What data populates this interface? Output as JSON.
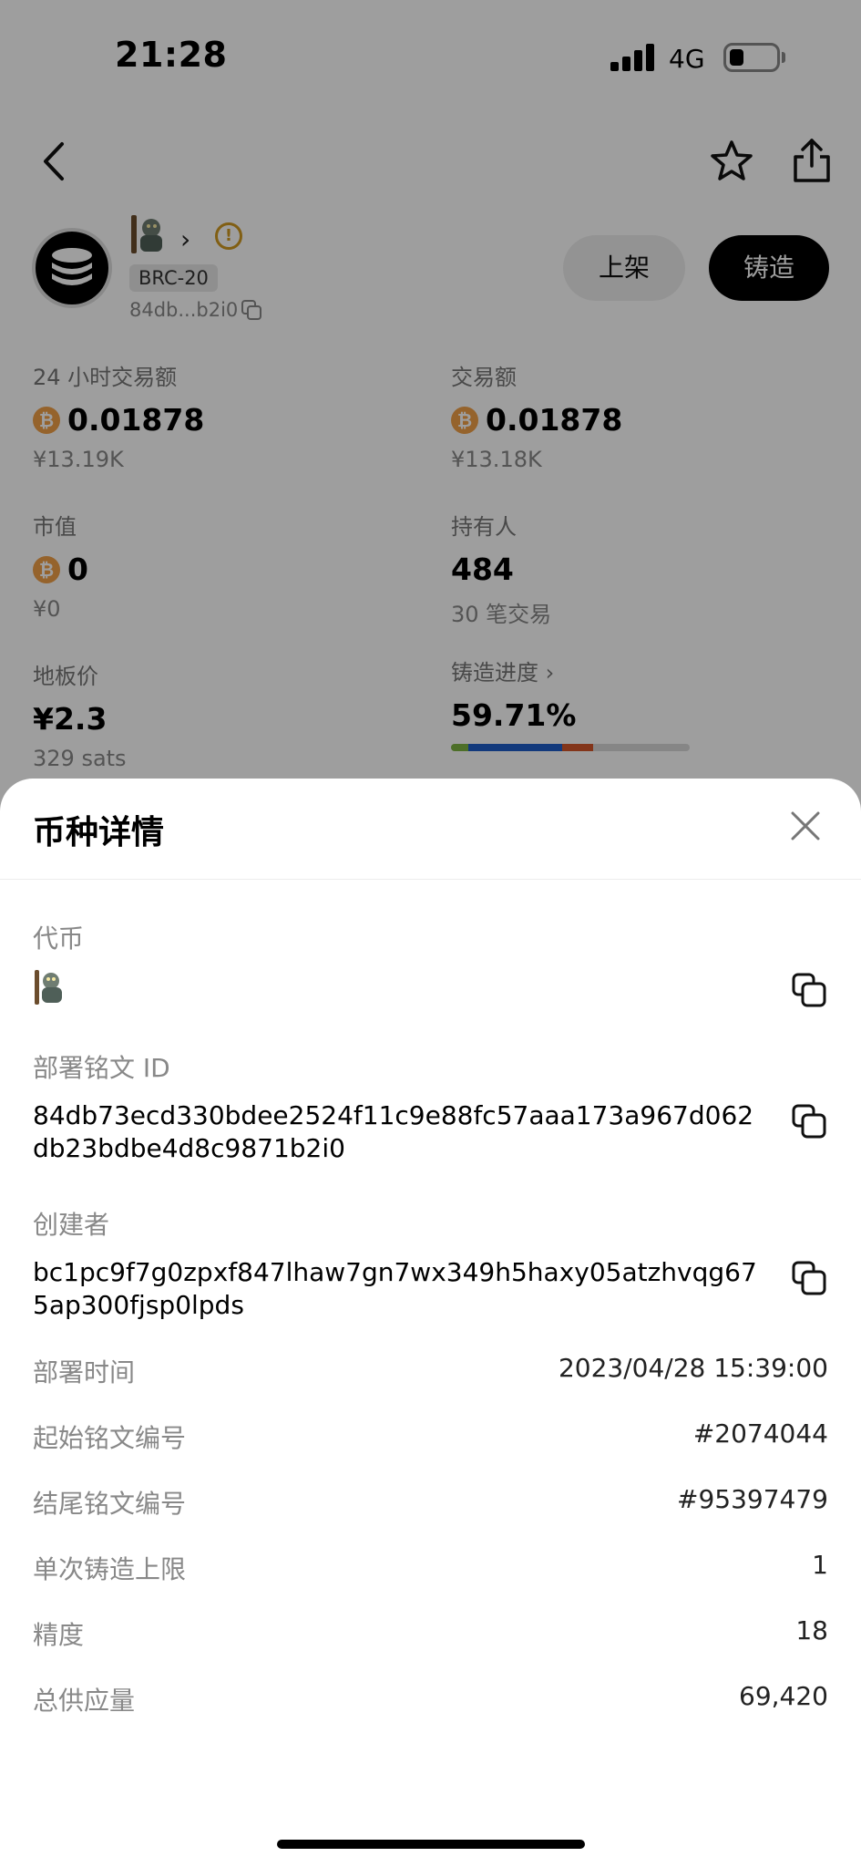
{
  "status": {
    "time": "21:28",
    "network": "4G"
  },
  "nav": {
    "back_icon": "chevron-left-icon",
    "star_icon": "star-icon",
    "share_icon": "share-icon"
  },
  "token": {
    "badge": "BRC-20",
    "address_short": "84db...b2i0",
    "list_label": "上架",
    "mint_label": "铸造",
    "warn_icon": "!"
  },
  "stats": {
    "vol24_label": "24 小时交易额",
    "vol24_value": "0.01878",
    "vol24_sub": "¥13.19K",
    "vol_label": "交易额",
    "vol_value": "0.01878",
    "vol_sub": "¥13.18K",
    "mcap_label": "市值",
    "mcap_value": "0",
    "mcap_sub": "¥0",
    "holders_label": "持有人",
    "holders_value": "484",
    "holders_sub": "30 笔交易",
    "floor_label": "地板价",
    "floor_value": "¥2.3",
    "floor_sub": "329 sats",
    "mint_progress_label": "铸造进度",
    "mint_progress_value": "59.71%",
    "mint_progress_fraction": 0.5971,
    "progress_colors": [
      "#7cb342",
      "#1e5cc8",
      "#d4562a",
      "#d8d8d8"
    ],
    "btc_symbol": "₿"
  },
  "sheet": {
    "title": "币种详情",
    "token_label": "代币",
    "deploy_id_label": "部署铭文 ID",
    "deploy_id_value": "84db73ecd330bdee2524f11c9e88fc57aaa173a967d062db23bdbe4d8c9871b2i0",
    "creator_label": "创建者",
    "creator_value": "bc1pc9f7g0zpxf847lhaw7gn7wx349h5haxy05atzhvqg675ap300fjsp0lpds",
    "rows": [
      {
        "label": "部署时间",
        "value": "2023/04/28 15:39:00"
      },
      {
        "label": "起始铭文编号",
        "value": "#2074044"
      },
      {
        "label": "结尾铭文编号",
        "value": "#95397479"
      },
      {
        "label": "单次铸造上限",
        "value": "1"
      },
      {
        "label": "精度",
        "value": "18"
      },
      {
        "label": "总供应量",
        "value": "69,420"
      }
    ]
  }
}
